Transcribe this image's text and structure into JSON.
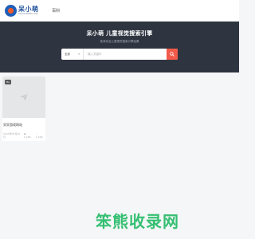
{
  "header": {
    "logo_name": "呆小萌",
    "logo_sub": "DAIXIAOMENG.COM",
    "nav_items": [
      {
        "label": "百科"
      }
    ]
  },
  "hero": {
    "title": "呆小萌 儿童视觉搜索引擎",
    "subtitle": "纯净安全儿童视觉搜索引擎结果"
  },
  "search": {
    "category": "全部",
    "placeholder": "输入关键字"
  },
  "cards": [
    {
      "badge": "ftv",
      "title": "呆呆游戏网站",
      "date": "2023年05月10日",
      "views": "1,299",
      "likes": "1,299"
    }
  ],
  "watermark": "笨熊收录网",
  "colors": {
    "accent": "#f25a4a",
    "hero_bg": "#2e3440",
    "watermark": "#2bbd6b"
  }
}
